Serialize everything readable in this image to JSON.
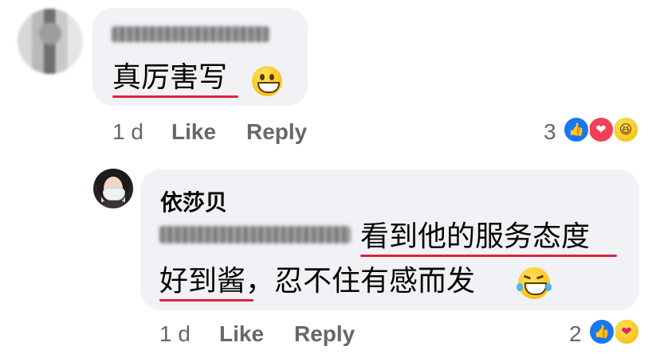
{
  "comments": [
    {
      "author": "",
      "text": "真厉害写",
      "time": "1 d",
      "like_label": "Like",
      "reply_label": "Reply",
      "reaction_count": "3",
      "reactions": [
        "like-icon",
        "love-icon",
        "haha-icon"
      ],
      "emoji": "grin-emoji"
    },
    {
      "author": "依莎贝",
      "text_line1": "看到他的服务态度",
      "text_line2": "好到酱，忍不住有感而发",
      "time": "1 d",
      "like_label": "Like",
      "reply_label": "Reply",
      "reaction_count": "2",
      "reactions": [
        "like-icon",
        "care-icon"
      ],
      "emoji": "tears-of-joy-emoji"
    }
  ],
  "colors": {
    "bubble": "#f0f2f5",
    "meta_text": "#65676b",
    "underline": "#d7263d",
    "like": "#1877f2",
    "love": "#f33e58"
  }
}
